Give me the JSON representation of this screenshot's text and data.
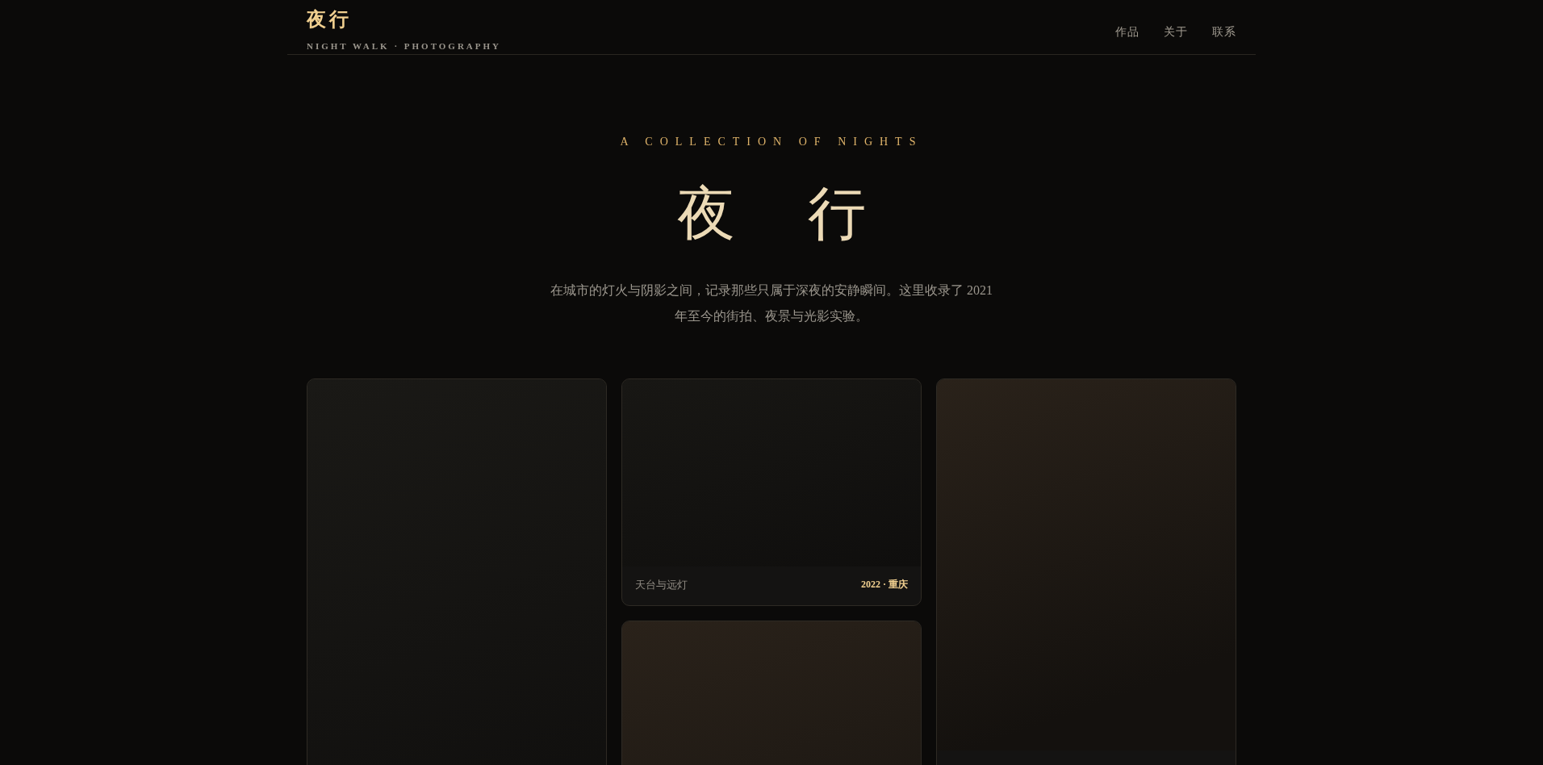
{
  "header": {
    "logo": "夜行",
    "tagline": "NIGHT WALK · PHOTOGRAPHY",
    "nav": [
      {
        "label": "作品"
      },
      {
        "label": "关于"
      },
      {
        "label": "联系"
      }
    ]
  },
  "hero": {
    "eyebrow": "A COLLECTION OF NIGHTS",
    "title": "夜 行",
    "intro": "在城市的灯火与阴影之间，记录那些只属于深夜的安静瞬间。这里收录了 2021 年至今的街拍、夜景与光影实验。"
  },
  "gallery": {
    "columns": [
      {
        "cards": [
          {
            "kind": "tall"
          }
        ]
      },
      {
        "cards": [
          {
            "kind": "wide",
            "caption": {
              "title": "天台与远灯",
              "meta": "2022 · 重庆"
            }
          },
          {
            "kind": "tall"
          }
        ]
      },
      {
        "cards": [
          {
            "kind": "portrait"
          }
        ]
      }
    ]
  }
}
